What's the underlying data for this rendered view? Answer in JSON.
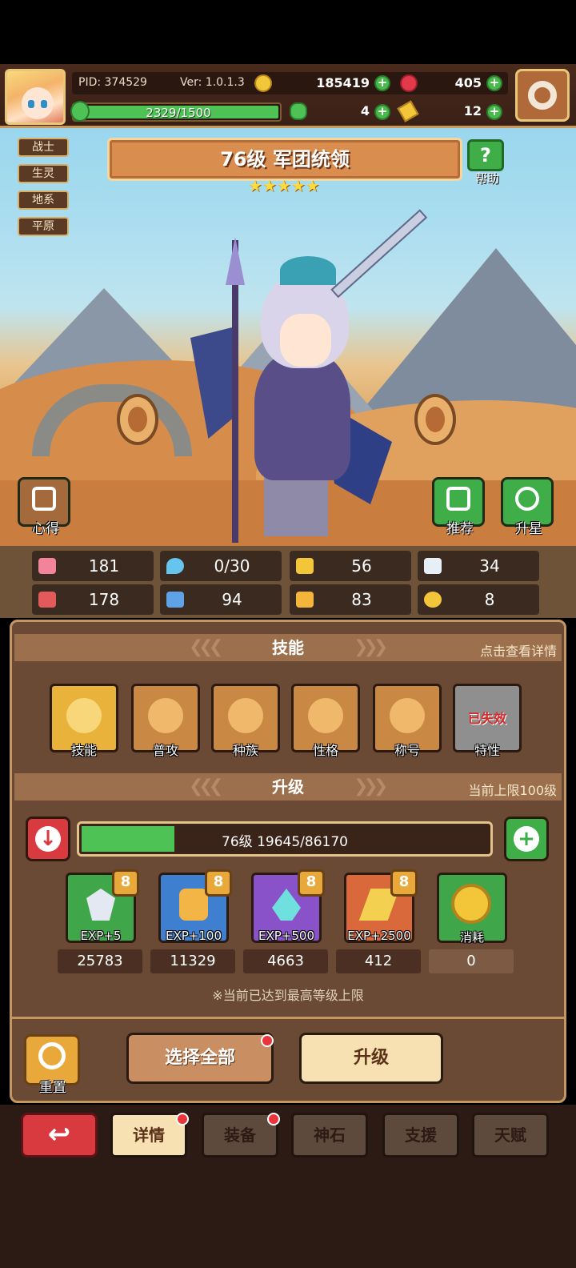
{
  "hud": {
    "pid": "PID: 374529",
    "version": "Ver: 1.0.1.3",
    "gold": "185419",
    "ruby": "405",
    "exp_text": "2329/1500",
    "exp_fill": 1.0,
    "clover": "4",
    "ticket": "12"
  },
  "tags": [
    "战士",
    "生灵",
    "地系",
    "平原"
  ],
  "title": "76级  军团统领",
  "stars": 5,
  "help_label": "帮助",
  "side_buttons": {
    "insight": "心得",
    "recommend": "推荐",
    "star_up": "升星"
  },
  "stats": {
    "hp": "181",
    "mana": "0/30",
    "defense": "56",
    "speed": "34",
    "attack": "178",
    "magic": "94",
    "stat7": "83",
    "stat8": "8"
  },
  "skills_section": {
    "title": "技能",
    "hint": "点击查看详情",
    "items": [
      "技能",
      "普攻",
      "种族",
      "性格",
      "称号",
      "特性"
    ],
    "expired_label": "已失效"
  },
  "upgrade_section": {
    "title": "升级",
    "hint": "当前上限100级",
    "bar_text": "76级  19645/86170",
    "progress": 0.228
  },
  "exp_items": [
    {
      "label": "EXP+5",
      "count": "25783",
      "badge": "8"
    },
    {
      "label": "EXP+100",
      "count": "11329",
      "badge": "8"
    },
    {
      "label": "EXP+500",
      "count": "4663",
      "badge": "8"
    },
    {
      "label": "EXP+2500",
      "count": "412",
      "badge": "8"
    },
    {
      "label": "消耗",
      "count": "0"
    }
  ],
  "max_level_note": "※当前已达到最高等级上限",
  "actions": {
    "reset": "重置",
    "select_all": "选择全部",
    "upgrade": "升级"
  },
  "tabs": [
    "详情",
    "装备",
    "神石",
    "支援",
    "天赋"
  ],
  "colors": {
    "accent_green": "#4fc255",
    "badge_red": "#e8343a",
    "panel_brown": "#6b4a35"
  }
}
